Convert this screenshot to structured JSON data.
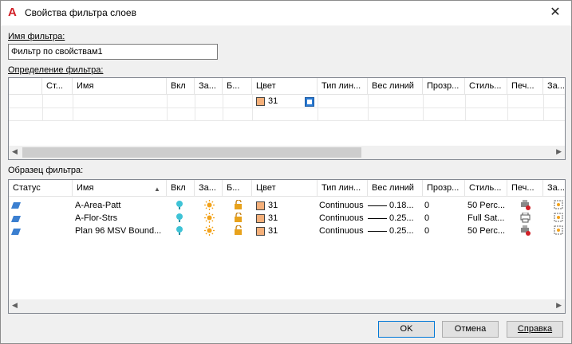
{
  "window": {
    "title": "Свойства фильтра слоев",
    "close_glyph": "✕",
    "app_icon_letter": "A"
  },
  "filter_name": {
    "label": "Имя фильтра:",
    "value": "Фильтр по свойствам1"
  },
  "definition": {
    "label": "Определение фильтра:",
    "columns": [
      "Ст...",
      "Имя",
      "Вкл",
      "За...",
      "Б...",
      "Цвет",
      "Тип лин...",
      "Вес линий",
      "Прозр...",
      "Стиль...",
      "Печ...",
      "За..."
    ],
    "row": {
      "color_value": "31"
    }
  },
  "preview": {
    "label": "Образец фильтра:",
    "columns": [
      "Статус",
      "Имя",
      "Вкл",
      "За...",
      "Б...",
      "Цвет",
      "Тип лин...",
      "Вес линий",
      "Прозр...",
      "Стиль...",
      "Печ...",
      "За..."
    ],
    "rows": [
      {
        "name": "A-Area-Patt",
        "color": "31",
        "linetype": "Continuous",
        "lineweight": "0.18...",
        "transparency": "0",
        "plot_style": "50 Perc..."
      },
      {
        "name": "A-Flor-Strs",
        "color": "31",
        "linetype": "Continuous",
        "lineweight": "0.25...",
        "transparency": "0",
        "plot_style": "Full Sat..."
      },
      {
        "name": "Plan 96 MSV Bound...",
        "color": "31",
        "linetype": "Continuous",
        "lineweight": "0.25...",
        "transparency": "0",
        "plot_style": "50 Perc..."
      }
    ]
  },
  "buttons": {
    "ok": "OK",
    "cancel": "Отмена",
    "help": "Справка"
  },
  "colors": {
    "swatch": "#f5b07a",
    "bulb": "#3ec3d6",
    "sun": "#f2a21b",
    "lock": "#e8a21b",
    "layer_status": "#3b7fd0"
  }
}
